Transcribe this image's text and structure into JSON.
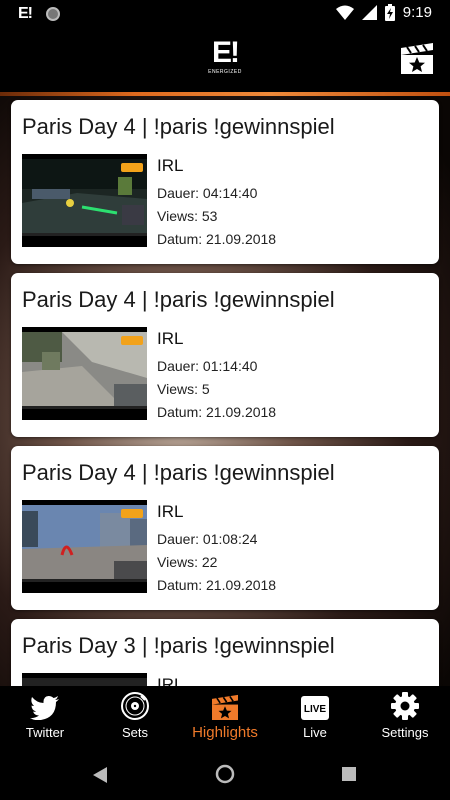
{
  "status_bar": {
    "left_icon": "E!",
    "time": "9:19"
  },
  "app": {
    "logo_text": "E!",
    "logo_subtext": "ENERGIZED"
  },
  "videos": [
    {
      "title": "Paris Day 4 | !paris !gewinnspiel",
      "category": "IRL",
      "duration": "Dauer: 04:14:40",
      "views": "Views: 53",
      "date": "Datum: 21.09.2018"
    },
    {
      "title": "Paris Day 4 | !paris !gewinnspiel",
      "category": "IRL",
      "duration": "Dauer: 01:14:40",
      "views": "Views: 5",
      "date": "Datum: 21.09.2018"
    },
    {
      "title": "Paris Day 4 | !paris !gewinnspiel",
      "category": "IRL",
      "duration": "Dauer: 01:08:24",
      "views": "Views: 22",
      "date": "Datum: 21.09.2018"
    },
    {
      "title": "Paris Day 3 | !paris !gewinnspiel",
      "category": "IRL",
      "duration": "",
      "views": "",
      "date": ""
    }
  ],
  "nav": {
    "items": [
      {
        "label": "Twitter",
        "icon": "twitter-bird-icon"
      },
      {
        "label": "Sets",
        "icon": "vinyl-disc-icon"
      },
      {
        "label": "Highlights",
        "icon": "clapperboard-star-icon",
        "active": true
      },
      {
        "label": "Live",
        "icon": "live-badge-icon",
        "badge_text": "LIVE"
      },
      {
        "label": "Settings",
        "icon": "gear-icon"
      }
    ]
  },
  "colors": {
    "accent": "#f07a2a",
    "background": "#000000",
    "card": "#ffffff"
  }
}
